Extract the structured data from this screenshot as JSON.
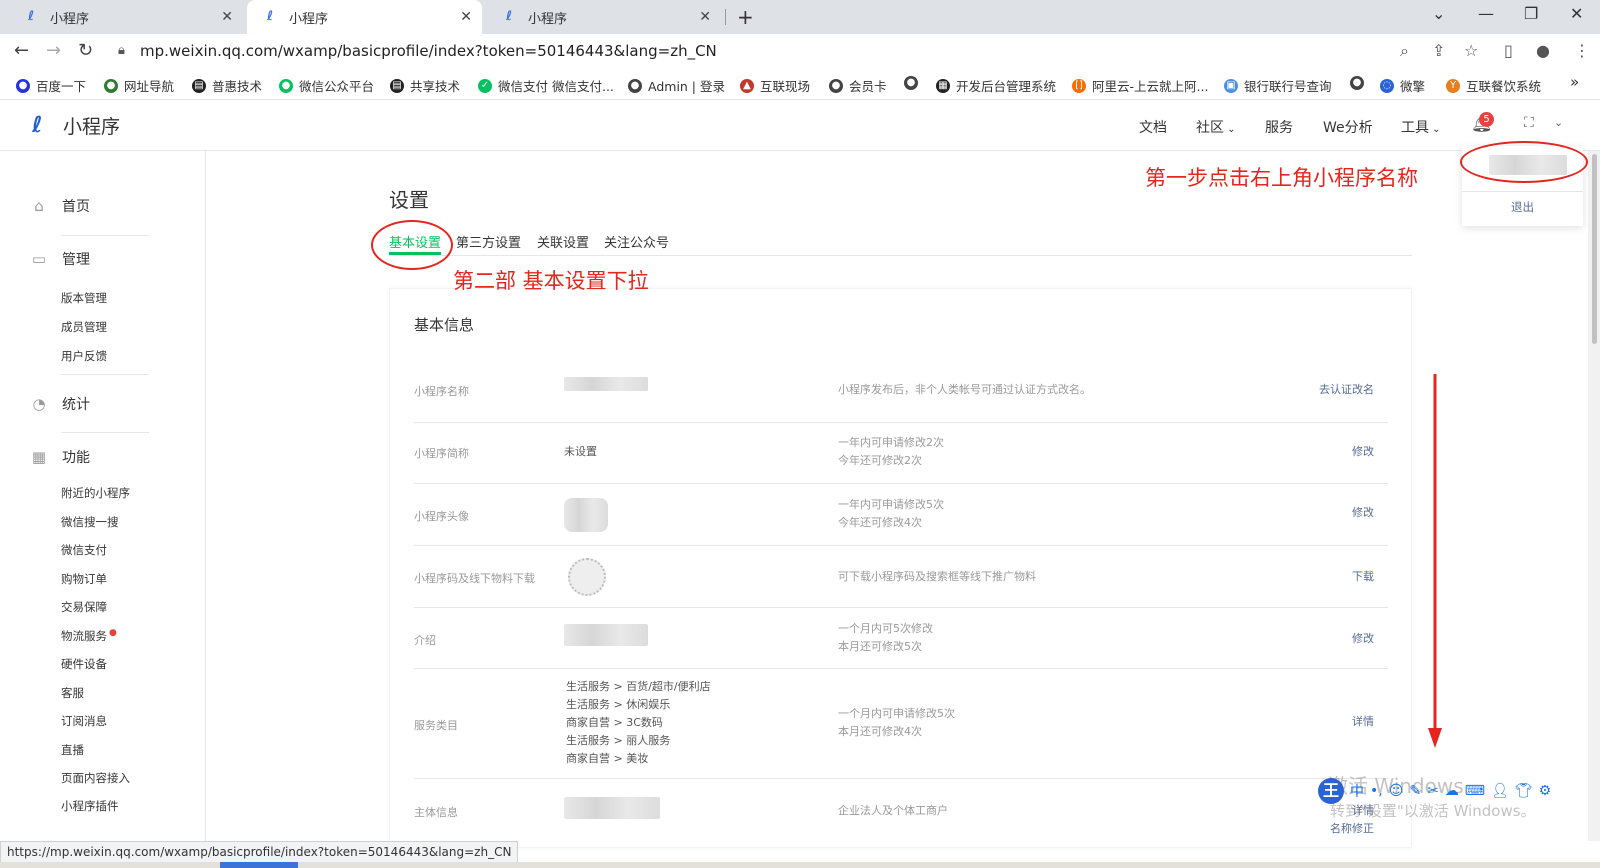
{
  "browser": {
    "tabs": [
      {
        "title": "小程序",
        "active": false
      },
      {
        "title": "小程序",
        "active": true
      },
      {
        "title": "小程序",
        "active": false
      }
    ],
    "url": "mp.weixin.qq.com/wxamp/basicprofile/index?token=50146443&lang=zh_CN",
    "bookmarks": [
      "百度一下",
      "网址导航",
      "普惠技术",
      "微信公众平台",
      "共享技术",
      "微信支付 微信支付...",
      "Admin | 登录",
      "互联现场",
      "会员卡",
      "开发后台管理系统",
      "阿里云-上云就上阿...",
      "银行联行号查询",
      "微擎",
      "互联餐饮系统"
    ],
    "more": "»"
  },
  "header": {
    "logo_text": "小程序",
    "nav": [
      "文档",
      "社区",
      "服务",
      "We分析",
      "工具"
    ],
    "notification_count": "5"
  },
  "account_menu": {
    "logout": "退出"
  },
  "sidebar": {
    "home": "首页",
    "manage": "管理",
    "manage_items": [
      "版本管理",
      "成员管理",
      "用户反馈"
    ],
    "stats": "统计",
    "features": "功能",
    "feature_items": [
      "附近的小程序",
      "微信搜一搜",
      "微信支付",
      "购物订单",
      "交易保障",
      "物流服务",
      "硬件设备",
      "客服",
      "订阅消息",
      "直播",
      "页面内容接入",
      "小程序插件"
    ]
  },
  "main": {
    "title": "设置",
    "tabs": [
      "基本设置",
      "第三方设置",
      "关联设置",
      "关注公众号"
    ],
    "card_title": "基本信息",
    "rows": [
      {
        "label": "小程序名称",
        "value": "",
        "desc": [
          "小程序发布后，非个人类帐号可通过认证方式改名。"
        ],
        "action": [
          "去认证改名"
        ]
      },
      {
        "label": "小程序简称",
        "value": "未设置",
        "desc": [
          "一年内可申请修改2次",
          "今年还可修改2次"
        ],
        "action": [
          "修改"
        ]
      },
      {
        "label": "小程序头像",
        "value": "",
        "desc": [
          "一年内可申请修改5次",
          "今年还可修改4次"
        ],
        "action": [
          "修改"
        ]
      },
      {
        "label": "小程序码及线下物料下载",
        "value": "",
        "desc": [
          "可下载小程序码及搜索框等线下推广物料"
        ],
        "action": [
          "下载"
        ]
      },
      {
        "label": "介绍",
        "value": "",
        "desc": [
          "一个月内可5次修改",
          "本月还可修改5次"
        ],
        "action": [
          "修改"
        ]
      },
      {
        "label": "服务类目",
        "value": "",
        "desc": [
          "一个月内可申请修改5次",
          "本月还可修改4次"
        ],
        "action": [
          "详情"
        ]
      },
      {
        "label": "主体信息",
        "value": "",
        "desc": [
          "企业法人及个体工商户"
        ],
        "action": [
          "详情",
          "名称修正"
        ]
      }
    ],
    "categories": [
      "生活服务 > 百货/超市/便利店",
      "生活服务 > 休闲娱乐",
      "商家自营 > 3C数码",
      "生活服务 > 丽人服务",
      "商家自营 > 美妆"
    ]
  },
  "annotations": {
    "step1": "第一步点击右上角小程序名称",
    "step2": "第二部 基本设置下拉"
  },
  "status_url": "https://mp.weixin.qq.com/wxamp/basicprofile/index?token=50146443&lang=zh_CN",
  "ime": {
    "logo": "王",
    "mode": "中"
  },
  "watermark": {
    "line1": "激活 Windows",
    "line2": "转到\"设置\"以激活 Windows。"
  },
  "colors": {
    "accent_green": "#07c160",
    "link_blue": "#576b95",
    "annotation_red": "#e5261e",
    "badge_red": "#e64340"
  }
}
